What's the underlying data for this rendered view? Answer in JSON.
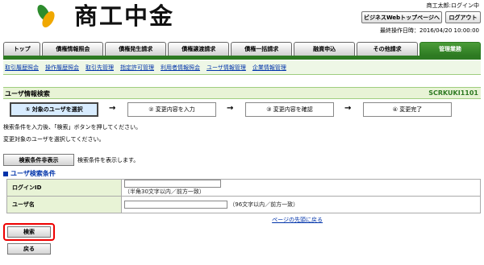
{
  "brand": {
    "name": "商工中金"
  },
  "header": {
    "user_name": "商工太郎:ログイン中",
    "btn_business_web": "ビジネスWebトップページへ",
    "btn_logout": "ログアウト",
    "last_login": "最終操作日時：2016/04/20 10:00:00"
  },
  "tabs": [
    "トップ",
    "債権情報照会",
    "債権発生請求",
    "債権譲渡請求",
    "債権一括請求",
    "融資申込",
    "その他請求",
    "管理業務"
  ],
  "subnav": [
    "取引履歴照会",
    "操作履歴照会",
    "取引先管理",
    "指定許可管理",
    "利用者情報照会",
    "ユーザ情報管理",
    "企業情報管理"
  ],
  "page": {
    "title": "ユーザ情報検索",
    "code": "SCRKUKI1101"
  },
  "steps": [
    "① 対象のユーザを選択",
    "② 変更内容を入力",
    "③ 変更内容を確認",
    "④ 変更完了"
  ],
  "step_arrow": "→",
  "messages": {
    "line1": "検索条件を入力後、「検索」ボタンを押してください。",
    "line2": "変更対象のユーザを選択してください。"
  },
  "cond_button": "検索条件非表示",
  "cond_note": "検索条件を表示します。",
  "section_title": "ユーザ検索条件",
  "form": {
    "login_label": "ログインID",
    "login_hint": "（半角30文字以内／前方一致）",
    "username_label": "ユーザ名",
    "username_hint": "（96文字以内／前方一致）"
  },
  "page_top_link": "ページの先頭に戻る",
  "search_button": "検索",
  "back_button": "戻る"
}
